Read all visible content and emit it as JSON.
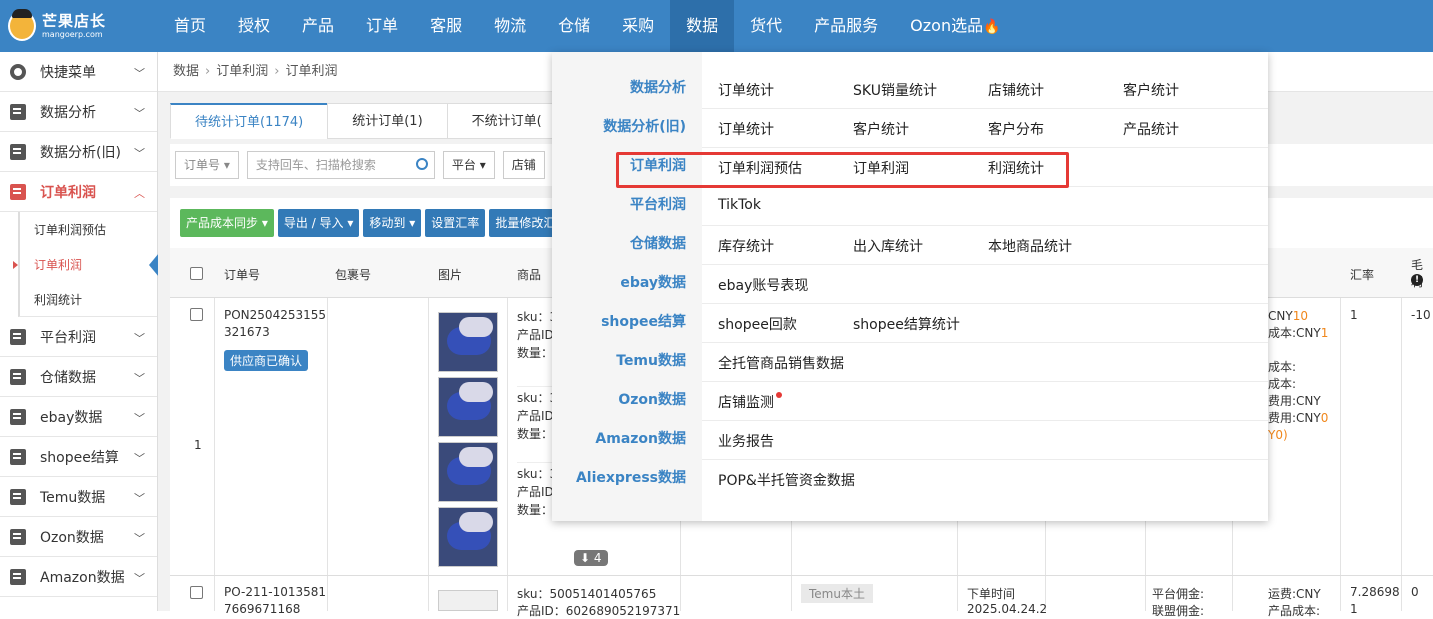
{
  "logo": {
    "title": "芒果店长",
    "subtitle": "mangoerp.com"
  },
  "nav": [
    {
      "label": "首页"
    },
    {
      "label": "授权"
    },
    {
      "label": "产品"
    },
    {
      "label": "订单"
    },
    {
      "label": "客服"
    },
    {
      "label": "物流"
    },
    {
      "label": "仓储"
    },
    {
      "label": "采购"
    },
    {
      "label": "数据"
    },
    {
      "label": "货代"
    },
    {
      "label": "产品服务"
    },
    {
      "label": "Ozon选品"
    }
  ],
  "nav_fire_icon": "🔥",
  "sidebar": {
    "items": [
      {
        "label": "快捷菜单",
        "icon": "gear-icon"
      },
      {
        "label": "数据分析",
        "icon": "doc-icon"
      },
      {
        "label": "数据分析(旧)",
        "icon": "doc-icon"
      },
      {
        "label": "订单利润",
        "icon": "doc-icon"
      },
      {
        "label": "平台利润",
        "icon": "doc-icon"
      },
      {
        "label": "仓储数据",
        "icon": "doc-icon"
      },
      {
        "label": "ebay数据",
        "icon": "doc-icon"
      },
      {
        "label": "shopee结算",
        "icon": "doc-icon"
      },
      {
        "label": "Temu数据",
        "icon": "doc-icon"
      },
      {
        "label": "Ozon数据",
        "icon": "doc-icon"
      },
      {
        "label": "Amazon数据",
        "icon": "doc-icon"
      }
    ],
    "subitems": [
      {
        "label": "订单利润预估"
      },
      {
        "label": "订单利润"
      },
      {
        "label": "利润统计"
      }
    ]
  },
  "breadcrumb": {
    "a": "数据",
    "b": "订单利润",
    "c": "订单利润"
  },
  "tabs": [
    {
      "label": "待统计订单(1174)"
    },
    {
      "label": "统计订单(1)"
    },
    {
      "label": "不统计订单("
    }
  ],
  "filters": {
    "order_no": "订单号",
    "search_placeholder": "支持回车、扫描枪搜索",
    "platform": "平台",
    "store": "店铺"
  },
  "toolbar": {
    "sync": "产品成本同步",
    "export": "导出 / 导入",
    "move": "移动到",
    "rate": "设置汇率",
    "batch": "批量修改汇"
  },
  "table": {
    "headers": {
      "order_no": "订单号",
      "package_no": "包裹号",
      "image": "图片",
      "product": "商品",
      "rate": "汇率",
      "gross": "毛利"
    },
    "row1": {
      "index": "1",
      "order_no_a": "PON2504253155",
      "order_no_b": "321673",
      "status_badge": "供应商已确认",
      "sku_lines": [
        "sku：3",
        "产品ID",
        "数量："
      ],
      "sku_lines2": [
        "sku：3",
        "产品ID",
        "数量："
      ],
      "sku_lines3": [
        "sku：3",
        "产品ID",
        "数量："
      ],
      "more_count": "4",
      "cost_a": "CNY",
      "cost_a_val": "10",
      "cost_b": "成本:CNY",
      "cost_b_val": "1",
      "cost_c": "成本:",
      "cost_d": "成本:",
      "cost_e": "费用:CNY",
      "cost_f": "费用:CNY",
      "cost_f_val": "0",
      "cost_g": "Y0)",
      "rate": "1",
      "gross": "-10"
    },
    "row2": {
      "order_no_a": "PO-211-1013581",
      "order_no_b": "7669671168",
      "sku": "sku：50051401405765",
      "pid": "产品ID：602689052197371",
      "tag": "Temu本土",
      "time_label": "下单时间",
      "time_val": "2025.04.24.2",
      "fee_a": "平台佣金:",
      "fee_b": "联盟佣金:",
      "ship": "运费:CNY",
      "cost": "产品成本:",
      "rate": "7.28698",
      "rate2": "1",
      "gross": "0"
    }
  },
  "mega_menu": {
    "rows": [
      {
        "cat": "数据分析",
        "links": [
          "订单统计",
          "SKU销量统计",
          "店铺统计",
          "客户统计"
        ]
      },
      {
        "cat": "数据分析(旧)",
        "links": [
          "订单统计",
          "客户统计",
          "客户分布",
          "产品统计"
        ]
      },
      {
        "cat": "订单利润",
        "links": [
          "订单利润预估",
          "订单利润",
          "利润统计"
        ]
      },
      {
        "cat": "平台利润",
        "links": [
          "TikTok"
        ]
      },
      {
        "cat": "仓储数据",
        "links": [
          "库存统计",
          "出入库统计",
          "本地商品统计"
        ]
      },
      {
        "cat": "ebay数据",
        "links": [
          "ebay账号表现"
        ]
      },
      {
        "cat": "shopee结算",
        "links": [
          "shopee回款",
          "shopee结算统计"
        ]
      },
      {
        "cat": "Temu数据",
        "links": [
          "全托管商品销售数据"
        ]
      },
      {
        "cat": "Ozon数据",
        "links": [
          "店铺监测"
        ]
      },
      {
        "cat": "Amazon数据",
        "links": [
          "业务报告"
        ]
      },
      {
        "cat": "Aliexpress数据",
        "links": [
          "POP&半托管资金数据"
        ]
      }
    ]
  }
}
